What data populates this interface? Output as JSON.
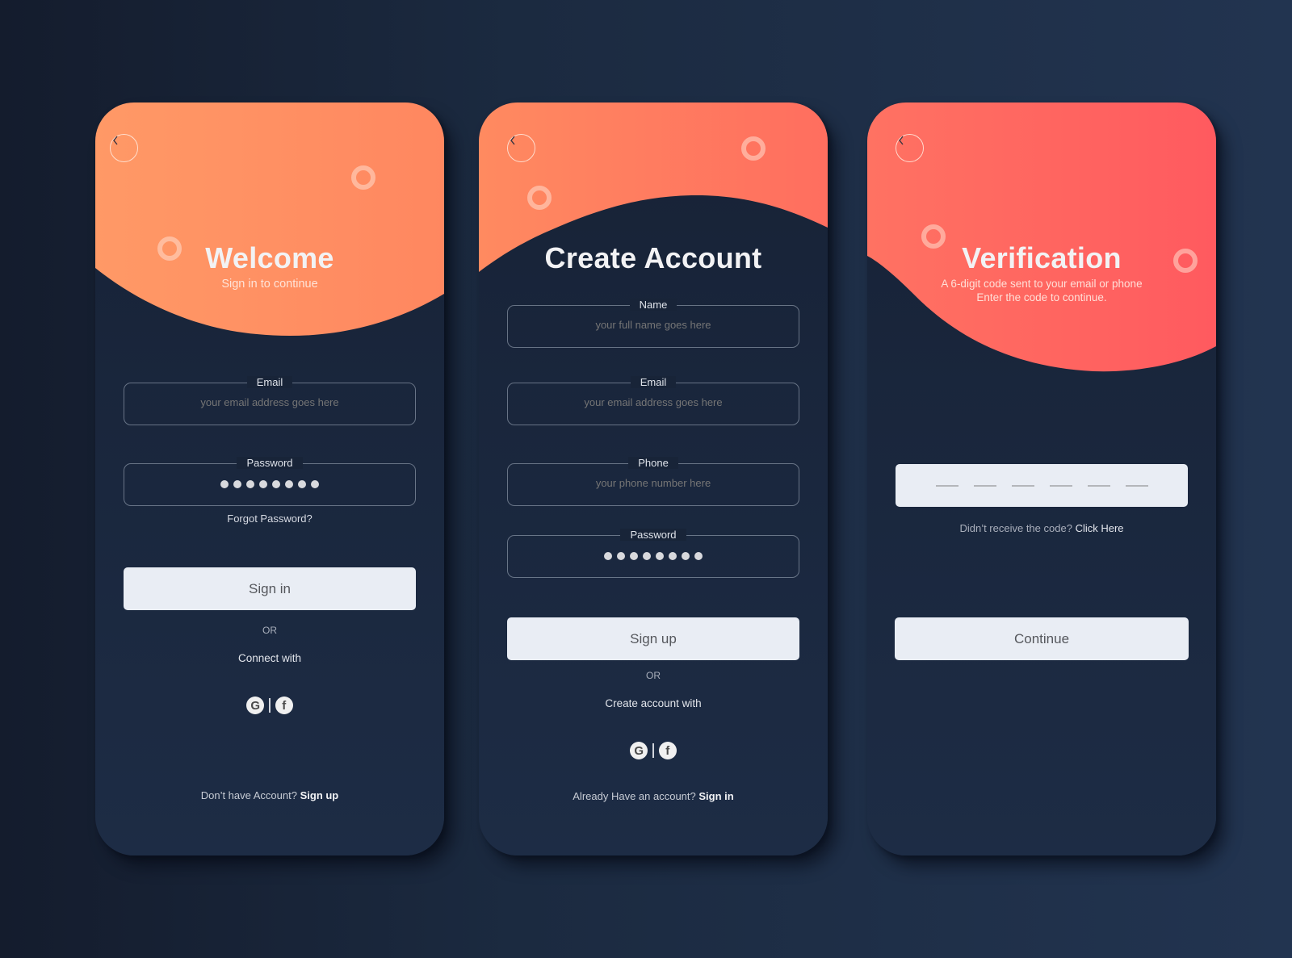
{
  "colors": {
    "background_left": "#141c2d",
    "background_right": "#223450",
    "card_dark": "#182438",
    "hero_welcome_from": "#ff9966",
    "hero_welcome_to": "#ff8a62",
    "hero_create_from": "#ff8a60",
    "hero_create_to": "#ff6e5f",
    "hero_verify_from": "#ff7262",
    "hero_verify_to": "#ff5a5f",
    "button_bg": "#e9edf4"
  },
  "screens": {
    "welcome": {
      "back_icon": "chevron-left-icon",
      "title": "Welcome",
      "subtitle": "Sign in to continue",
      "email": {
        "label": "Email",
        "placeholder": "your email address goes here"
      },
      "password": {
        "label": "Password",
        "masked_length": 8
      },
      "forgot_password": "Forgot Password?",
      "primary_button": "Sign in",
      "or": "OR",
      "connect_text": "Connect with",
      "social": [
        "google-icon",
        "facebook-icon"
      ],
      "footer_text": "Don’t have Account?",
      "footer_link": "Sign up"
    },
    "create_account": {
      "back_icon": "chevron-left-icon",
      "title": "Create Account",
      "name": {
        "label": "Name",
        "placeholder": "your full name goes here"
      },
      "email": {
        "label": "Email",
        "placeholder": "your email address goes here"
      },
      "phone": {
        "label": "Phone",
        "placeholder": "your phone number here"
      },
      "password": {
        "label": "Password",
        "masked_length": 8
      },
      "primary_button": "Sign up",
      "or": "OR",
      "connect_text": "Create account with",
      "social": [
        "google-icon",
        "facebook-icon"
      ],
      "footer_text": "Already Have an account?",
      "footer_link": "Sign in"
    },
    "verification": {
      "back_icon": "chevron-left-icon",
      "title": "Verification",
      "subtitle_line1": "A 6-digit code sent to your email or phone",
      "subtitle_line2": "Enter the code to continue.",
      "code_length": 6,
      "resend_text": "Didn’t receive the code?",
      "resend_link": "Click Here",
      "primary_button": "Continue"
    }
  }
}
